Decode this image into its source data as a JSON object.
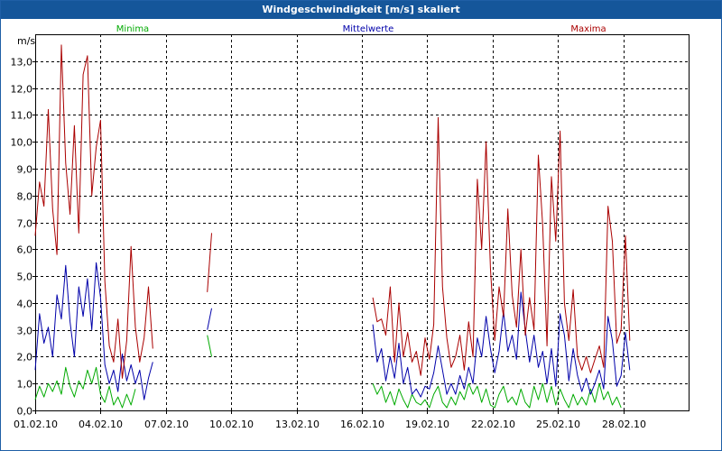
{
  "window": {
    "title": "Windgeschwindigkeit [m/s] skaliert"
  },
  "chart_data": {
    "type": "line",
    "title": "Windgeschwindigkeit [m/s] skaliert",
    "ylabel": "m/s",
    "xlabel": "",
    "ylim": [
      0,
      14
    ],
    "xlim": [
      0,
      30
    ],
    "grid": true,
    "legend_placement": "top",
    "x_ticks": [
      0,
      3,
      6,
      9,
      12,
      15,
      18,
      21,
      24,
      27
    ],
    "x_tick_labels": [
      "01.02.10",
      "04.02.10",
      "07.02.10",
      "10.02.10",
      "13.02.10",
      "16.02.10",
      "19.02.10",
      "22.02.10",
      "25.02.10",
      "28.02.10"
    ],
    "y_ticks": [
      0,
      1,
      2,
      3,
      4,
      5,
      6,
      7,
      8,
      9,
      10,
      11,
      12,
      13
    ],
    "y_tick_labels": [
      "0,0",
      "1,0",
      "2,0",
      "3,0",
      "4,0",
      "5,0",
      "6,0",
      "7,0",
      "8,0",
      "9,0",
      "10,0",
      "11,0",
      "12,0",
      "13,0"
    ],
    "series": [
      {
        "name": "Minima",
        "color": "#00aa00",
        "segments": [
          [
            [
              0.0,
              0.4
            ],
            [
              0.2,
              0.9
            ],
            [
              0.4,
              0.5
            ],
            [
              0.6,
              1.0
            ],
            [
              0.8,
              0.7
            ],
            [
              1.0,
              1.1
            ],
            [
              1.2,
              0.6
            ],
            [
              1.4,
              1.6
            ],
            [
              1.6,
              0.9
            ],
            [
              1.8,
              0.5
            ],
            [
              2.0,
              1.1
            ],
            [
              2.2,
              0.8
            ],
            [
              2.4,
              1.5
            ],
            [
              2.6,
              1.0
            ],
            [
              2.8,
              1.6
            ],
            [
              3.0,
              0.6
            ],
            [
              3.2,
              0.3
            ],
            [
              3.4,
              0.9
            ],
            [
              3.6,
              0.2
            ],
            [
              3.8,
              0.5
            ],
            [
              4.0,
              0.1
            ],
            [
              4.2,
              0.6
            ],
            [
              4.4,
              0.2
            ],
            [
              4.6,
              0.8
            ]
          ],
          [
            [
              7.9,
              2.8
            ],
            [
              8.1,
              2.0
            ]
          ],
          [
            [
              15.5,
              1.0
            ],
            [
              15.7,
              0.6
            ],
            [
              15.9,
              0.9
            ],
            [
              16.1,
              0.3
            ],
            [
              16.3,
              0.7
            ],
            [
              16.5,
              0.2
            ],
            [
              16.7,
              0.8
            ],
            [
              16.9,
              0.4
            ],
            [
              17.1,
              0.1
            ],
            [
              17.3,
              0.6
            ],
            [
              17.5,
              0.3
            ],
            [
              17.7,
              0.2
            ],
            [
              17.9,
              0.4
            ],
            [
              18.1,
              0.1
            ],
            [
              18.3,
              0.6
            ],
            [
              18.5,
              0.9
            ],
            [
              18.7,
              0.3
            ],
            [
              18.9,
              0.1
            ],
            [
              19.1,
              0.5
            ],
            [
              19.3,
              0.2
            ],
            [
              19.5,
              0.7
            ],
            [
              19.7,
              0.4
            ],
            [
              19.9,
              1.0
            ],
            [
              20.1,
              0.6
            ],
            [
              20.3,
              0.9
            ],
            [
              20.5,
              0.3
            ],
            [
              20.7,
              0.8
            ],
            [
              20.9,
              0.2
            ],
            [
              21.1,
              0.1
            ],
            [
              21.3,
              0.6
            ],
            [
              21.5,
              0.9
            ],
            [
              21.7,
              0.3
            ],
            [
              21.9,
              0.5
            ],
            [
              22.1,
              0.2
            ],
            [
              22.3,
              0.8
            ],
            [
              22.5,
              0.3
            ],
            [
              22.7,
              0.1
            ],
            [
              22.9,
              0.9
            ],
            [
              23.1,
              0.4
            ],
            [
              23.3,
              1.0
            ],
            [
              23.5,
              0.3
            ],
            [
              23.7,
              0.9
            ],
            [
              23.9,
              0.2
            ],
            [
              24.1,
              0.8
            ],
            [
              24.3,
              0.4
            ],
            [
              24.5,
              0.1
            ],
            [
              24.7,
              0.6
            ],
            [
              24.9,
              0.2
            ],
            [
              25.1,
              0.5
            ],
            [
              25.3,
              0.2
            ],
            [
              25.5,
              0.8
            ],
            [
              25.7,
              0.3
            ],
            [
              25.9,
              1.0
            ],
            [
              26.1,
              0.4
            ],
            [
              26.3,
              0.7
            ],
            [
              26.5,
              0.2
            ],
            [
              26.7,
              0.5
            ],
            [
              26.9,
              0.1
            ]
          ]
        ]
      },
      {
        "name": "Mittelwerte",
        "color": "#0000aa",
        "segments": [
          [
            [
              0.0,
              1.5
            ],
            [
              0.2,
              3.6
            ],
            [
              0.4,
              2.5
            ],
            [
              0.6,
              3.1
            ],
            [
              0.8,
              2.0
            ],
            [
              1.0,
              4.3
            ],
            [
              1.2,
              3.4
            ],
            [
              1.4,
              5.4
            ],
            [
              1.6,
              3.3
            ],
            [
              1.8,
              2.0
            ],
            [
              2.0,
              4.6
            ],
            [
              2.2,
              3.5
            ],
            [
              2.4,
              4.9
            ],
            [
              2.6,
              3.0
            ],
            [
              2.8,
              5.5
            ],
            [
              3.0,
              4.2
            ],
            [
              3.2,
              1.7
            ],
            [
              3.4,
              1.0
            ],
            [
              3.6,
              1.5
            ],
            [
              3.8,
              0.7
            ],
            [
              4.0,
              2.1
            ],
            [
              4.2,
              1.1
            ],
            [
              4.4,
              1.7
            ],
            [
              4.6,
              1.0
            ],
            [
              4.8,
              1.5
            ],
            [
              5.0,
              0.4
            ],
            [
              5.2,
              1.2
            ],
            [
              5.4,
              1.8
            ]
          ],
          [
            [
              7.9,
              3.0
            ],
            [
              8.1,
              3.8
            ]
          ],
          [
            [
              15.5,
              3.2
            ],
            [
              15.7,
              1.8
            ],
            [
              15.9,
              2.3
            ],
            [
              16.1,
              1.1
            ],
            [
              16.3,
              2.0
            ],
            [
              16.5,
              1.2
            ],
            [
              16.7,
              2.5
            ],
            [
              16.9,
              1.0
            ],
            [
              17.1,
              1.6
            ],
            [
              17.3,
              0.6
            ],
            [
              17.5,
              0.8
            ],
            [
              17.7,
              0.5
            ],
            [
              17.9,
              0.9
            ],
            [
              18.1,
              0.8
            ],
            [
              18.3,
              1.4
            ],
            [
              18.5,
              2.4
            ],
            [
              18.7,
              1.5
            ],
            [
              18.9,
              0.6
            ],
            [
              19.1,
              1.0
            ],
            [
              19.3,
              0.6
            ],
            [
              19.5,
              1.3
            ],
            [
              19.7,
              0.8
            ],
            [
              19.9,
              1.6
            ],
            [
              20.1,
              1.0
            ],
            [
              20.3,
              2.7
            ],
            [
              20.5,
              2.0
            ],
            [
              20.7,
              3.5
            ],
            [
              20.9,
              2.3
            ],
            [
              21.1,
              1.4
            ],
            [
              21.3,
              2.2
            ],
            [
              21.5,
              3.7
            ],
            [
              21.7,
              2.2
            ],
            [
              21.9,
              2.8
            ],
            [
              22.1,
              1.9
            ],
            [
              22.3,
              4.4
            ],
            [
              22.5,
              3.0
            ],
            [
              22.7,
              1.8
            ],
            [
              22.9,
              2.8
            ],
            [
              23.1,
              1.6
            ],
            [
              23.3,
              2.2
            ],
            [
              23.5,
              1.0
            ],
            [
              23.7,
              2.3
            ],
            [
              23.9,
              0.9
            ],
            [
              24.1,
              3.6
            ],
            [
              24.3,
              2.8
            ],
            [
              24.5,
              1.1
            ],
            [
              24.7,
              2.3
            ],
            [
              24.9,
              1.3
            ],
            [
              25.1,
              0.7
            ],
            [
              25.3,
              1.2
            ],
            [
              25.5,
              0.6
            ],
            [
              25.7,
              1.0
            ],
            [
              25.9,
              1.5
            ],
            [
              26.1,
              0.8
            ],
            [
              26.3,
              3.5
            ],
            [
              26.5,
              2.6
            ],
            [
              26.7,
              0.9
            ],
            [
              26.9,
              1.3
            ],
            [
              27.1,
              2.9
            ],
            [
              27.3,
              1.5
            ]
          ]
        ]
      },
      {
        "name": "Maxima",
        "color": "#aa0000",
        "segments": [
          [
            [
              0.0,
              6.5
            ],
            [
              0.2,
              8.5
            ],
            [
              0.4,
              7.6
            ],
            [
              0.6,
              11.2
            ],
            [
              0.8,
              7.5
            ],
            [
              1.0,
              5.8
            ],
            [
              1.2,
              13.6
            ],
            [
              1.4,
              9.2
            ],
            [
              1.6,
              7.3
            ],
            [
              1.8,
              10.6
            ],
            [
              2.0,
              6.6
            ],
            [
              2.2,
              12.5
            ],
            [
              2.4,
              13.2
            ],
            [
              2.6,
              8.0
            ],
            [
              2.8,
              9.8
            ],
            [
              3.0,
              10.8
            ],
            [
              3.2,
              4.8
            ],
            [
              3.4,
              2.4
            ],
            [
              3.6,
              1.8
            ],
            [
              3.8,
              3.4
            ],
            [
              4.0,
              1.2
            ],
            [
              4.2,
              2.6
            ],
            [
              4.4,
              6.1
            ],
            [
              4.6,
              3.1
            ],
            [
              4.8,
              1.8
            ],
            [
              5.0,
              2.7
            ],
            [
              5.2,
              4.6
            ],
            [
              5.4,
              2.3
            ]
          ],
          [
            [
              7.9,
              4.4
            ],
            [
              8.1,
              6.6
            ]
          ],
          [
            [
              15.5,
              4.2
            ],
            [
              15.7,
              3.3
            ],
            [
              15.9,
              3.4
            ],
            [
              16.1,
              2.8
            ],
            [
              16.3,
              4.6
            ],
            [
              16.5,
              1.8
            ],
            [
              16.7,
              4.0
            ],
            [
              16.9,
              2.0
            ],
            [
              17.1,
              2.9
            ],
            [
              17.3,
              1.8
            ],
            [
              17.5,
              2.2
            ],
            [
              17.7,
              1.3
            ],
            [
              17.9,
              2.7
            ],
            [
              18.1,
              1.9
            ],
            [
              18.3,
              3.2
            ],
            [
              18.5,
              10.9
            ],
            [
              18.7,
              4.6
            ],
            [
              18.9,
              2.7
            ],
            [
              19.1,
              1.6
            ],
            [
              19.3,
              2.0
            ],
            [
              19.5,
              2.8
            ],
            [
              19.7,
              1.5
            ],
            [
              19.9,
              3.3
            ],
            [
              20.1,
              2.0
            ],
            [
              20.3,
              8.6
            ],
            [
              20.5,
              6.0
            ],
            [
              20.7,
              10.0
            ],
            [
              20.9,
              5.3
            ],
            [
              21.1,
              2.6
            ],
            [
              21.3,
              4.6
            ],
            [
              21.5,
              3.5
            ],
            [
              21.7,
              7.5
            ],
            [
              21.9,
              4.3
            ],
            [
              22.1,
              3.1
            ],
            [
              22.3,
              6.0
            ],
            [
              22.5,
              2.8
            ],
            [
              22.7,
              4.2
            ],
            [
              22.9,
              3.0
            ],
            [
              23.1,
              9.5
            ],
            [
              23.3,
              6.9
            ],
            [
              23.5,
              2.4
            ],
            [
              23.7,
              8.7
            ],
            [
              23.9,
              6.3
            ],
            [
              24.1,
              10.4
            ],
            [
              24.3,
              4.0
            ],
            [
              24.5,
              2.6
            ],
            [
              24.7,
              4.5
            ],
            [
              24.9,
              2.0
            ],
            [
              25.1,
              1.5
            ],
            [
              25.3,
              2.0
            ],
            [
              25.5,
              1.4
            ],
            [
              25.7,
              1.9
            ],
            [
              25.9,
              2.4
            ],
            [
              26.1,
              1.6
            ],
            [
              26.3,
              7.6
            ],
            [
              26.5,
              6.3
            ],
            [
              26.7,
              2.5
            ],
            [
              26.9,
              3.0
            ],
            [
              27.1,
              6.5
            ],
            [
              27.3,
              2.6
            ]
          ]
        ]
      }
    ]
  }
}
